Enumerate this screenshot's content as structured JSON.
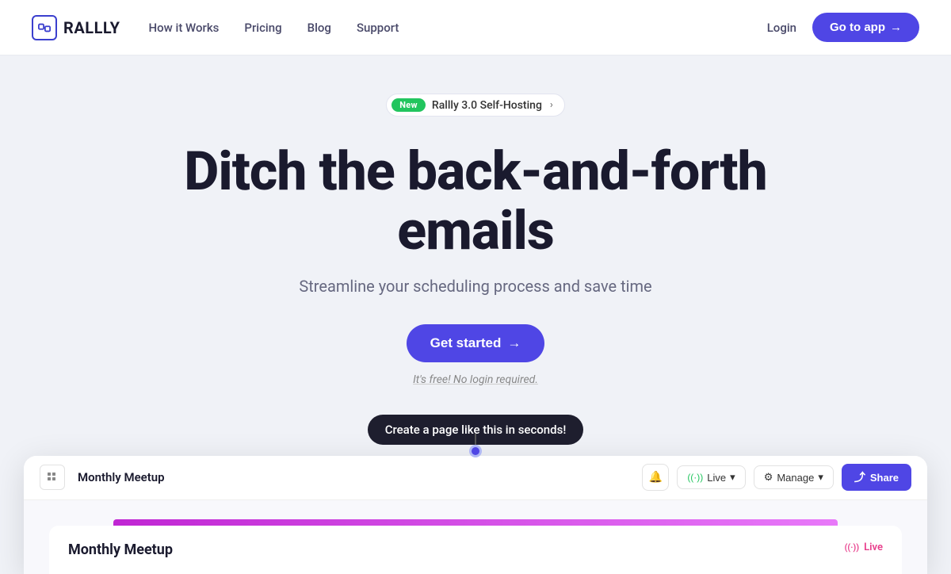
{
  "nav": {
    "logo_text": "RALLLY",
    "links": [
      {
        "label": "How it Works",
        "href": "#"
      },
      {
        "label": "Pricing",
        "href": "#"
      },
      {
        "label": "Blog",
        "href": "#"
      },
      {
        "label": "Support",
        "href": "#"
      }
    ],
    "login_label": "Login",
    "go_to_app_label": "Go to app",
    "go_to_app_arrow": "→"
  },
  "announcement": {
    "badge_label": "New",
    "text": "Rallly 3.0 Self-Hosting",
    "arrow": "›"
  },
  "hero": {
    "title": "Ditch the back-and-forth emails",
    "subtitle": "Streamline your scheduling process and save time",
    "cta_label": "Get started",
    "cta_arrow": "→",
    "free_text": "It's free! No login required."
  },
  "tooltip": {
    "text": "Create a page like this in seconds!"
  },
  "app_preview": {
    "page_name": "Monthly Meetup",
    "bell_icon": "🔔",
    "live_label": "Live",
    "live_arrow": "▾",
    "manage_label": "Manage",
    "manage_arrow": "▾",
    "share_label": "Share",
    "share_icon": "⤴",
    "gear_icon": "⚙"
  },
  "inner_card": {
    "title": "Monthly Meetup",
    "live_badge": "Live",
    "live_icon": "((·))"
  },
  "colors": {
    "accent": "#4f46e5",
    "green": "#22c55e",
    "pink": "#e83e8c",
    "dark": "#1a1a2e",
    "bg": "#f0f2f7"
  }
}
